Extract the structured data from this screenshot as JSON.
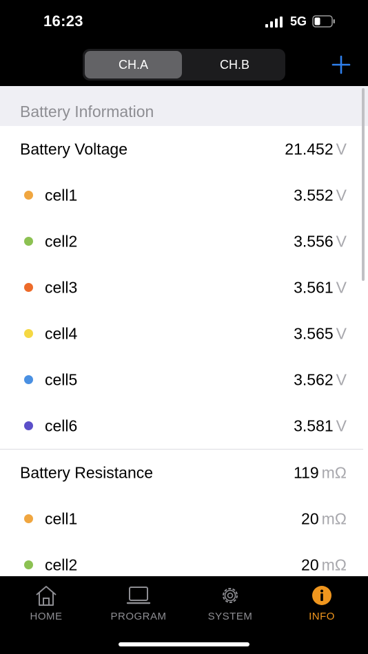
{
  "status": {
    "time": "16:23",
    "network": "5G"
  },
  "segments": {
    "a": "CH.A",
    "b": "CH.B"
  },
  "section_title": "Battery Information",
  "voltage": {
    "label": "Battery Voltage",
    "value": "21.452",
    "unit": "V",
    "cells": [
      {
        "name": "cell1",
        "value": "3.552",
        "unit": "V",
        "color": "#f0a640"
      },
      {
        "name": "cell2",
        "value": "3.556",
        "unit": "V",
        "color": "#8cc152"
      },
      {
        "name": "cell3",
        "value": "3.561",
        "unit": "V",
        "color": "#ed6b2a"
      },
      {
        "name": "cell4",
        "value": "3.565",
        "unit": "V",
        "color": "#f5d843"
      },
      {
        "name": "cell5",
        "value": "3.562",
        "unit": "V",
        "color": "#4a90e2"
      },
      {
        "name": "cell6",
        "value": "3.581",
        "unit": "V",
        "color": "#5b4fc9"
      }
    ]
  },
  "resistance": {
    "label": "Battery Resistance",
    "value": "119",
    "unit": "mΩ",
    "cells": [
      {
        "name": "cell1",
        "value": "20",
        "unit": "mΩ",
        "color": "#f0a640"
      },
      {
        "name": "cell2",
        "value": "20",
        "unit": "mΩ",
        "color": "#8cc152"
      }
    ]
  },
  "tabs": {
    "home": "HOME",
    "program": "PROGRAM",
    "system": "SYSTEM",
    "info": "INFO"
  },
  "colors": {
    "accent": "#f0961e",
    "plus": "#2f80ed"
  }
}
